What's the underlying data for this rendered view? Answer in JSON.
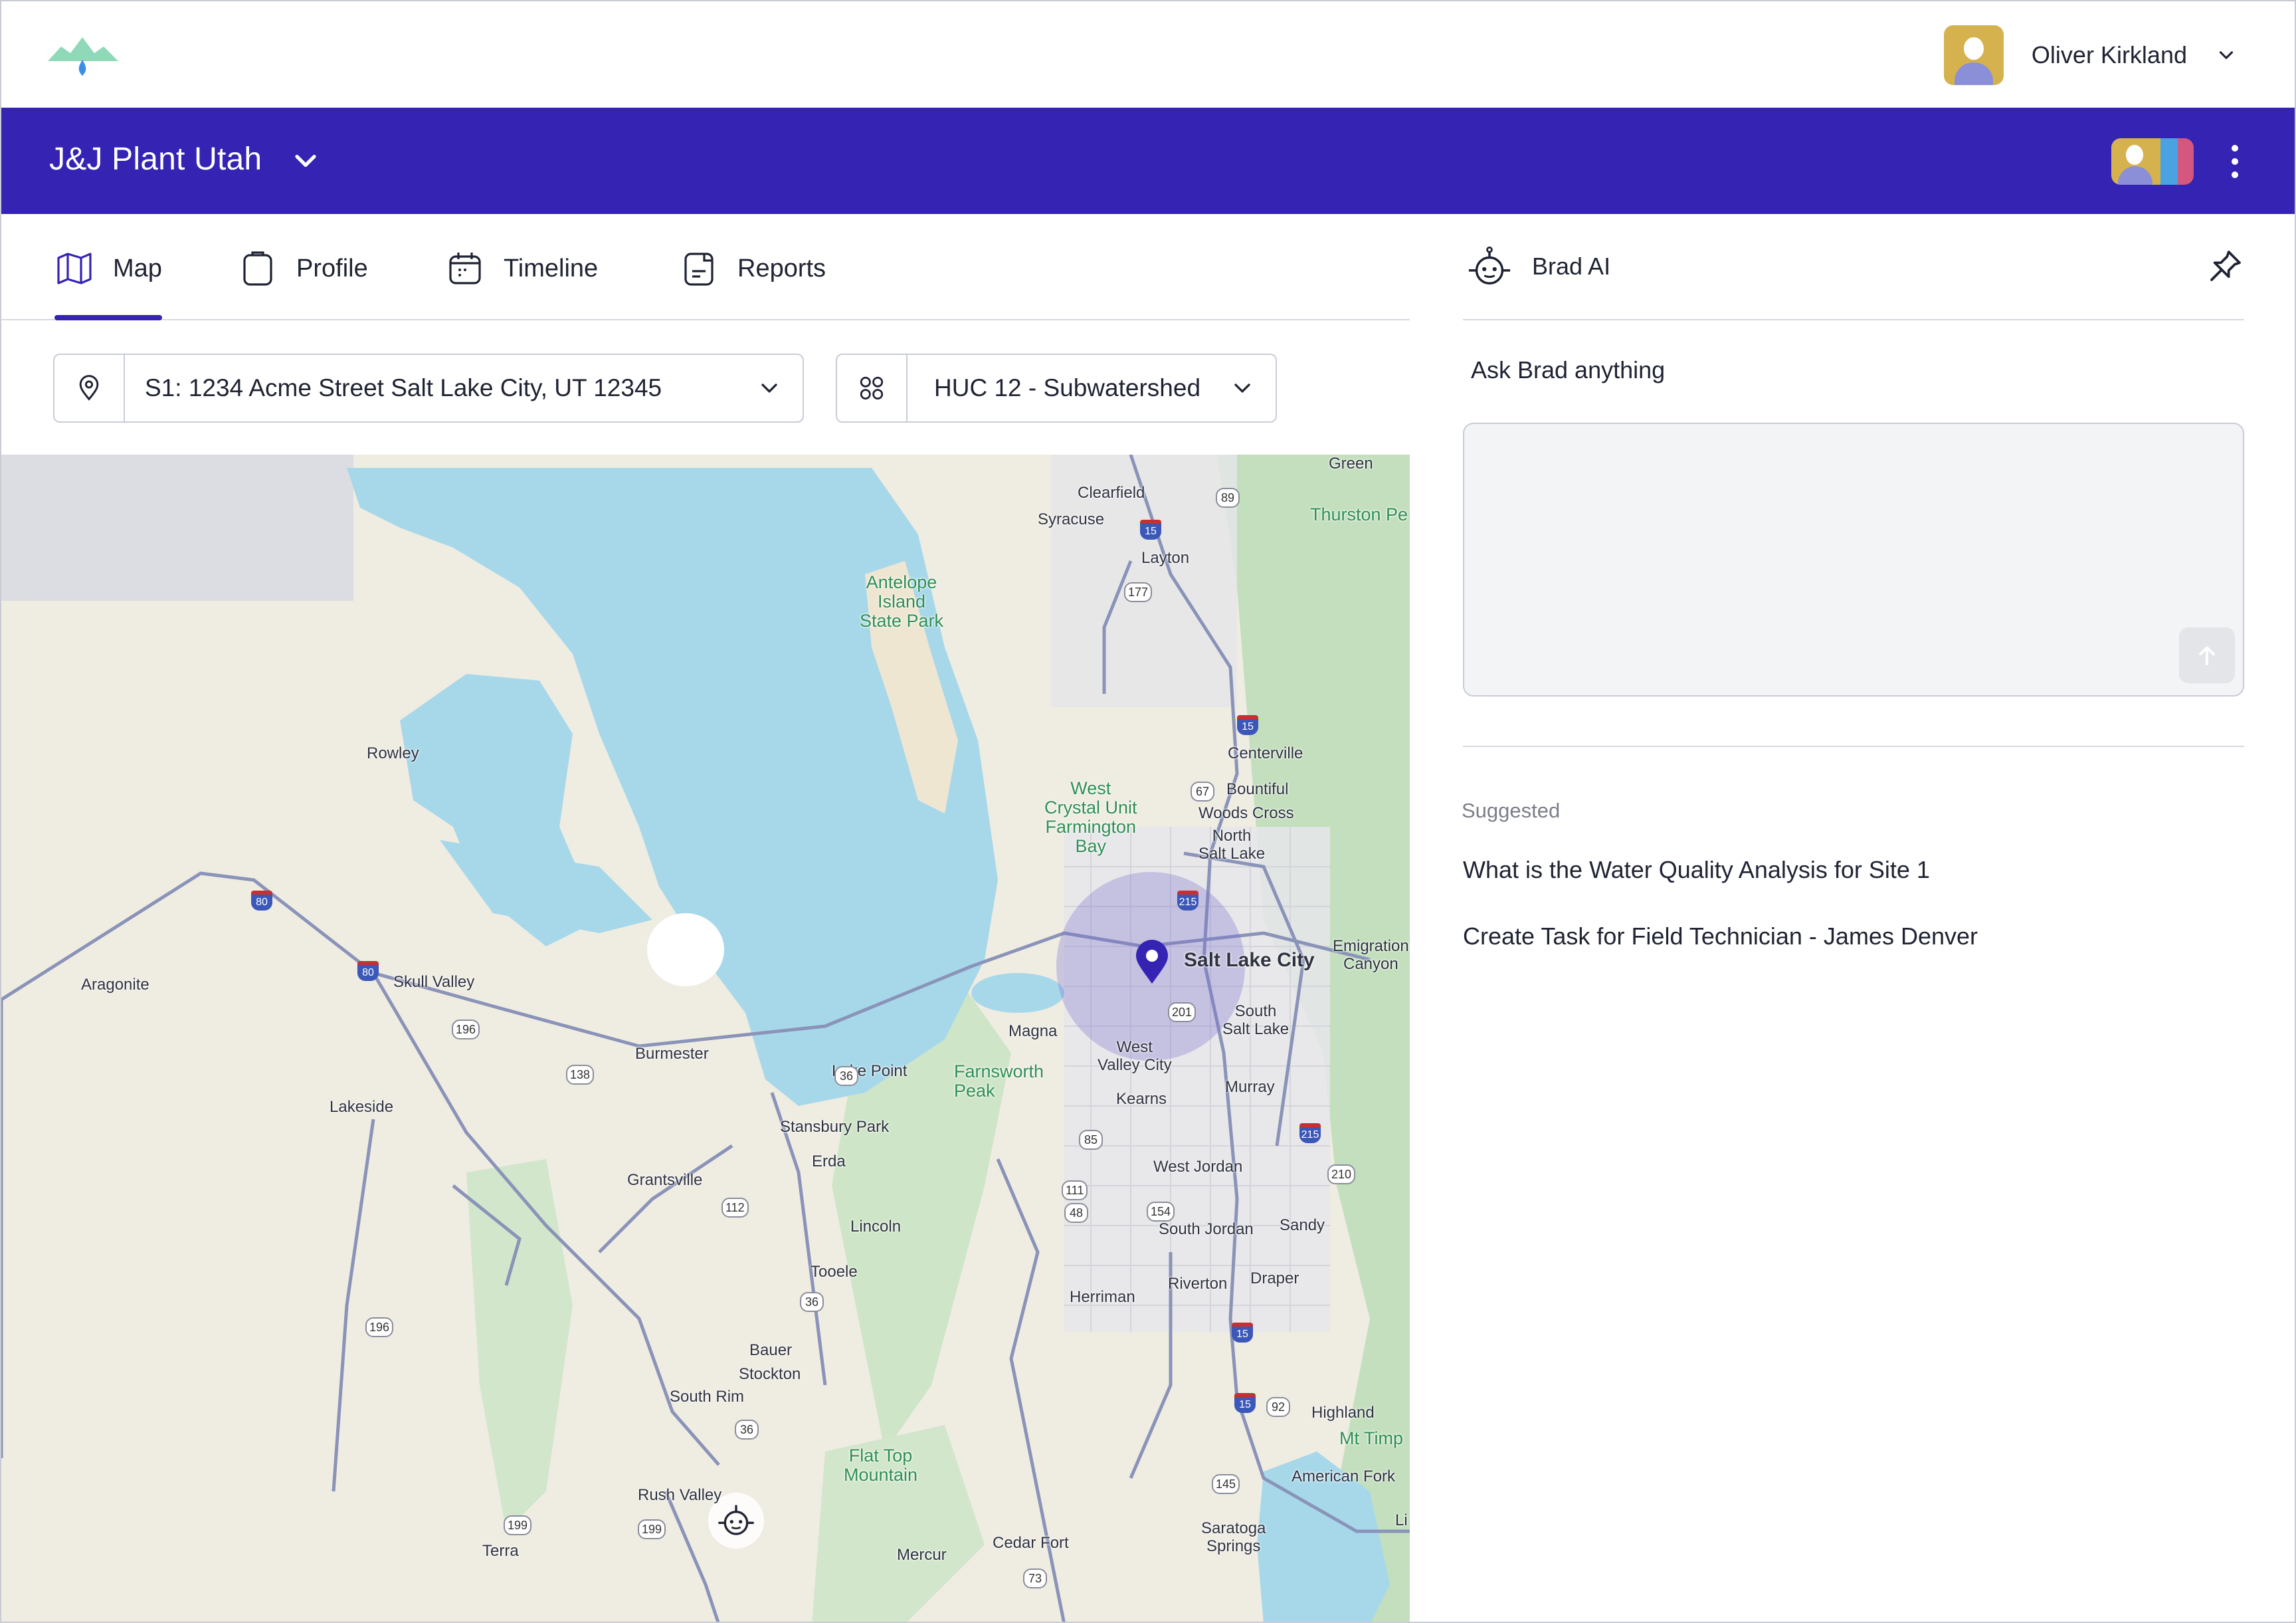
{
  "user": {
    "name": "Oliver Kirkland"
  },
  "project": {
    "title": "J&J Plant Utah"
  },
  "tabs": [
    {
      "label": "Map",
      "icon": "map-icon",
      "active": true
    },
    {
      "label": "Profile",
      "icon": "clipboard-icon"
    },
    {
      "label": "Timeline",
      "icon": "calendar-icon"
    },
    {
      "label": "Reports",
      "icon": "report-icon"
    }
  ],
  "filters": {
    "site": {
      "value": "S1: 1234 Acme Street Salt Lake City, UT 12345",
      "icon": "location-pin-icon"
    },
    "layer": {
      "value": "HUC 12 - Subwatershed",
      "icon": "grid-icon"
    }
  },
  "map": {
    "labels": {
      "green": "Green",
      "clearfield": "Clearfield",
      "syracuse": "Syracuse",
      "thurston": "Thurston Pe",
      "layton": "Layton",
      "antelope": "Antelope\nIsland\nState Park",
      "rowley": "Rowley",
      "centerville": "Centerville",
      "bountiful": "Bountiful",
      "woods_cross": "Woods Cross",
      "west_crystal": "West\nCrystal Unit\nFarmington\nBay",
      "north_slc": "North\nSalt Lake",
      "emigration": "Emigration\nCanyon",
      "slc": "Salt Lake City",
      "aragonite": "Aragonite",
      "skull_valley": "Skull Valley",
      "south_sl": "South\nSalt Lake",
      "magna": "Magna",
      "west_valley": "West\nValley City",
      "burmester": "Burmester",
      "lake_point": "Lake Point",
      "farnsworth": "Farnsworth\nPeak",
      "murray": "Murray",
      "lakeside": "Lakeside",
      "kearns": "Kearns",
      "stansbury": "Stansbury Park",
      "erda": "Erda",
      "grantsville": "Grantsville",
      "west_jordan": "West Jordan",
      "lincoln": "Lincoln",
      "south_jordan": "South Jordan",
      "sandy": "Sandy",
      "tooele": "Tooele",
      "draper": "Draper",
      "riverton": "Riverton",
      "herriman": "Herriman",
      "bauer": "Bauer",
      "stockton": "Stockton",
      "south_rim": "South Rim",
      "highland": "Highland",
      "mt_timp": "Mt Timp",
      "flat_top": "Flat Top\nMountain",
      "american_fork": "American Fork",
      "rush_valley": "Rush Valley",
      "saratoga": "Saratoga\nSprings",
      "terra": "Terra",
      "mercur": "Mercur",
      "cedar_fort": "Cedar Fort",
      "li": "Li"
    },
    "shields": [
      "89",
      "177",
      "67",
      "201",
      "196",
      "138",
      "112",
      "36",
      "85",
      "111",
      "48",
      "154",
      "210",
      "196",
      "199",
      "199",
      "145",
      "92",
      "36",
      "36",
      "73"
    ],
    "interstates": [
      "15",
      "15",
      "215",
      "215",
      "80",
      "80",
      "15",
      "15"
    ],
    "site_marker": "location-pin-icon"
  },
  "assistant": {
    "title": "Brad AI",
    "icon": "robot-icon",
    "ask_label": "Ask Brad anything",
    "input_value": "",
    "suggested_label": "Suggested",
    "suggestions": [
      "What is the Water Quality Analysis for Site 1",
      "Create Task for Field Technician - James Denver"
    ]
  },
  "colors": {
    "brand": "#3523b3",
    "water": "#a7d8ea",
    "park": "#c9e3c4"
  }
}
